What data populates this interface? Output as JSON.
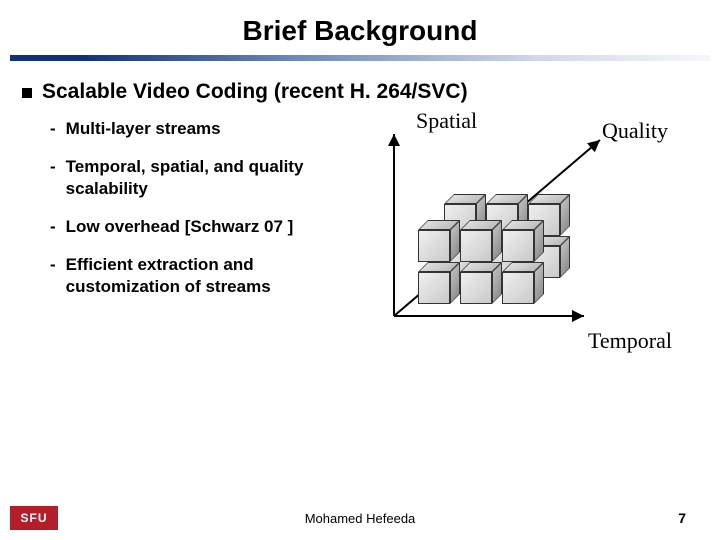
{
  "slide": {
    "title": "Brief Background",
    "heading": "Scalable Video Coding (recent H. 264/SVC)",
    "bullets": [
      "Multi-layer streams",
      "Temporal, spatial, and quality scalability",
      "Low overhead [Schwarz 07 ]",
      "Efficient extraction and customization of streams"
    ]
  },
  "diagram": {
    "axes": {
      "spatial": "Spatial",
      "quality": "Quality",
      "temporal": "Temporal"
    }
  },
  "footer": {
    "logo_text": "SFU",
    "author": "Mohamed  Hefeeda",
    "page": "7"
  }
}
